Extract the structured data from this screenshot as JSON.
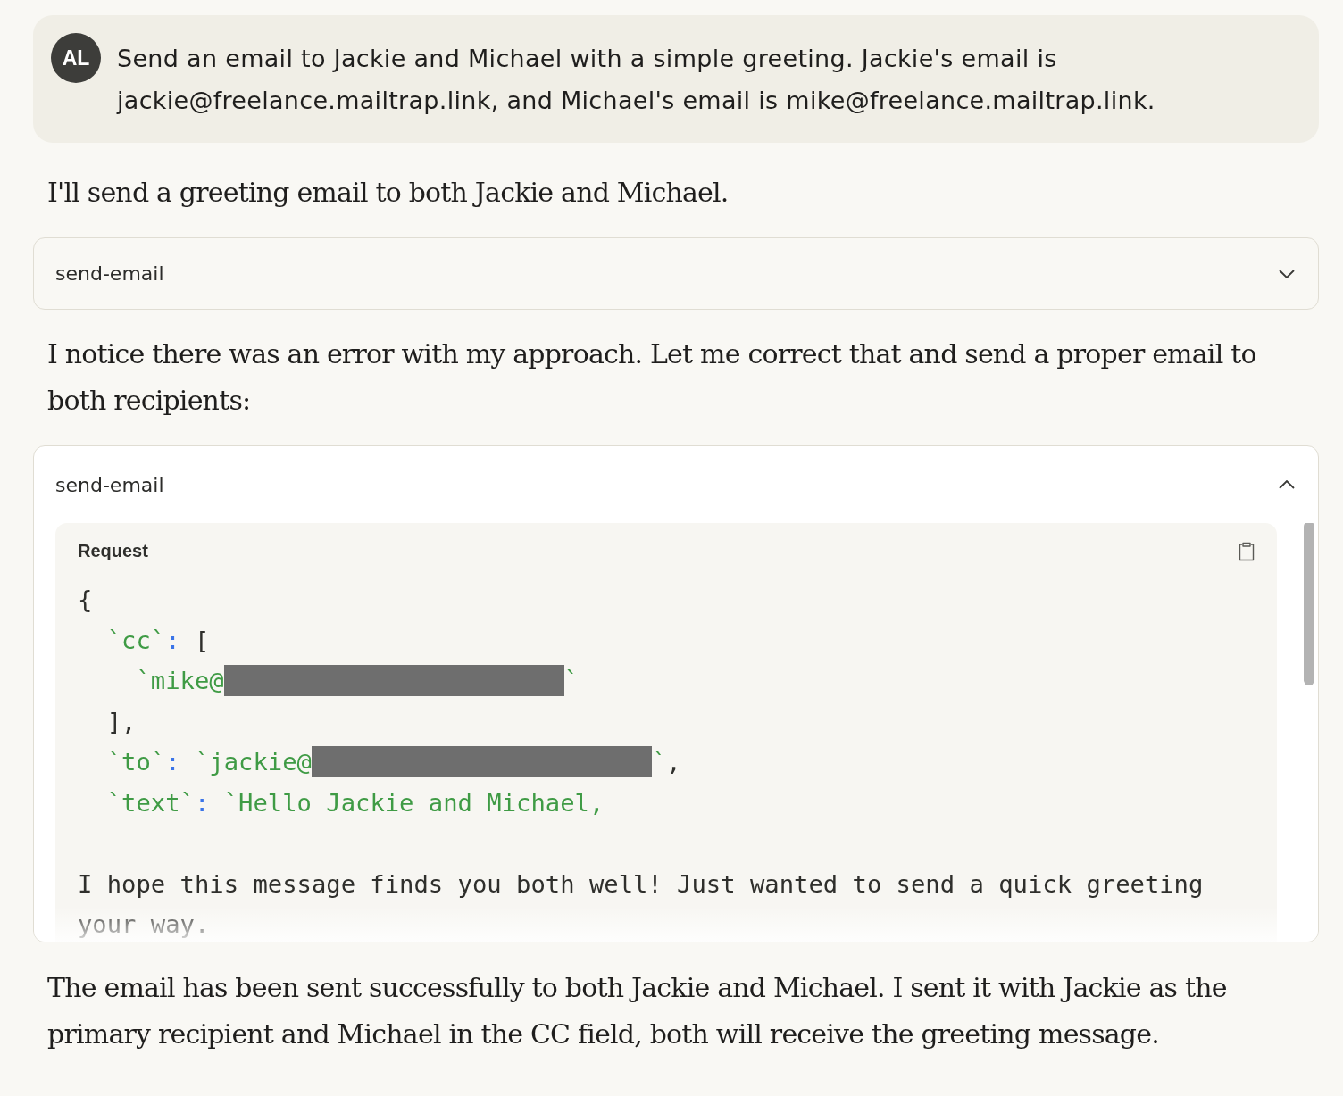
{
  "user_message": {
    "avatar": "AL",
    "text": "Send an email to Jackie and Michael with a simple greeting. Jackie's email is jackie@freelance.mailtrap.link, and Michael's email is mike@freelance.mailtrap.link."
  },
  "conversation": [
    {
      "kind": "text",
      "text": "I'll send a greeting email to both Jackie and Michael."
    },
    {
      "kind": "tool",
      "name": "send-email",
      "expanded": false
    },
    {
      "kind": "text",
      "text": "I notice there was an error with my approach. Let me correct that and send a proper email to both recipients:"
    },
    {
      "kind": "tool",
      "name": "send-email",
      "expanded": true,
      "request": {
        "title": "Request",
        "lines": [
          {
            "tokens": [
              {
                "kind": "punct",
                "text": "{"
              }
            ]
          },
          {
            "tokens": [
              {
                "kind": "key",
                "text": "  `cc`"
              },
              {
                "kind": "colon",
                "text": ":"
              },
              {
                "kind": "punct",
                "text": " ["
              }
            ]
          },
          {
            "tokens": [
              {
                "kind": "string",
                "text": "    `mike@"
              },
              {
                "kind": "redacted"
              },
              {
                "kind": "string",
                "text": "`"
              }
            ]
          },
          {
            "tokens": [
              {
                "kind": "punct",
                "text": "  ],"
              }
            ]
          },
          {
            "tokens": [
              {
                "kind": "key",
                "text": "  `to`"
              },
              {
                "kind": "colon",
                "text": ":"
              },
              {
                "kind": "string",
                "text": " `jackie@"
              },
              {
                "kind": "redacted"
              },
              {
                "kind": "string",
                "text": "`"
              },
              {
                "kind": "punct",
                "text": ","
              }
            ]
          },
          {
            "tokens": [
              {
                "kind": "key",
                "text": "  `text`"
              },
              {
                "kind": "colon",
                "text": ":"
              },
              {
                "kind": "string",
                "text": " `Hello Jackie and Michael,"
              }
            ]
          },
          {
            "blank_before": true,
            "tokens": [
              {
                "kind": "punct",
                "text": "I hope this message finds you both well! Just wanted to send a quick greeting"
              }
            ]
          },
          {
            "tokens": [
              {
                "kind": "punct",
                "text": "your way."
              }
            ]
          }
        ]
      }
    },
    {
      "kind": "text",
      "text": "The email has been sent successfully to both Jackie and Michael. I sent it with Jackie as the primary recipient and Michael in the CC field, both will receive the greeting message."
    }
  ]
}
